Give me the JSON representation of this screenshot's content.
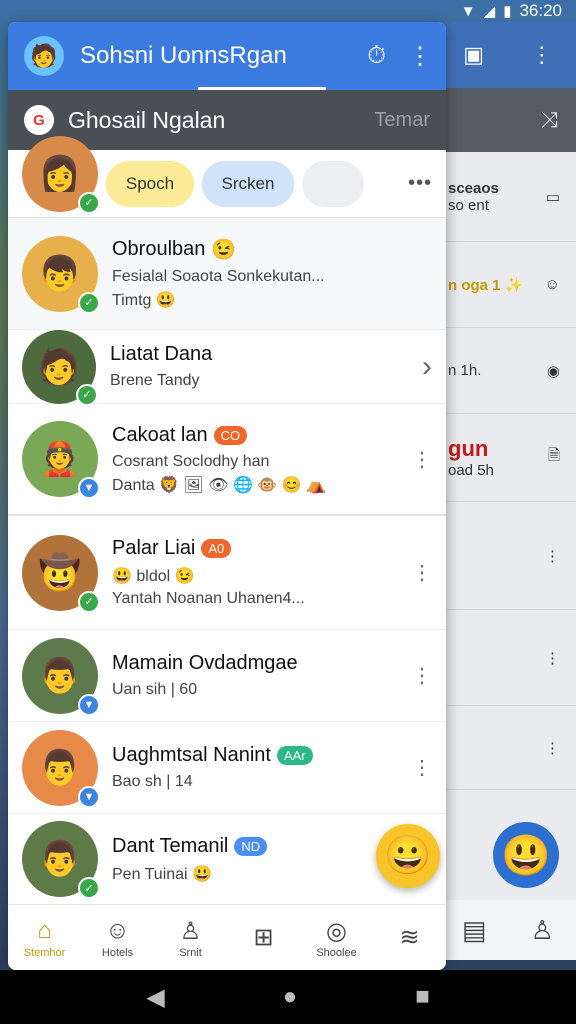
{
  "status": {
    "time": "36:20",
    "signal_icon": "signal-icon",
    "wifi_icon": "wifi-icon",
    "battery_icon": "battery-icon"
  },
  "appbar": {
    "title": "Sohsni UonnsRgan",
    "logo_icon": "app-logo-icon",
    "actions": [
      "timer-icon",
      "more-vert-icon"
    ]
  },
  "subbar": {
    "title": "Ghosail Ngalan",
    "right_text": "Temar",
    "logo_icon": "google-logo-icon"
  },
  "chips": {
    "items": [
      "Spoch",
      "Srcken",
      ""
    ],
    "more": "•••"
  },
  "contacts": [
    {
      "name": "Obroulban",
      "emoji": "😉",
      "line1": "Fesialal Soaota Sonkekutan...",
      "line2": "Timtg 😃",
      "trailing": "none",
      "badge_color": "#3aa84a"
    },
    {
      "name": "Liatat Dana",
      "line1": "Brene Tandy",
      "trailing": "chevron",
      "badge_color": "#3aa84a"
    },
    {
      "name": "Cakoat lan",
      "tag": "CO",
      "tag_color": "#f0662a",
      "line1": "Cosrant Soclodhy han",
      "line2": "Danta 🦁 🖼 👁 🌐 🐵 😊 ⛺",
      "trailing": "dots",
      "badge_color": "#3c84e2"
    },
    {
      "name": "Palar Liai",
      "tag": "A0",
      "tag_color": "#f0662a",
      "line1": "😃 bldol 😉",
      "line2": "Yantah Noanan Uhanen4...",
      "trailing": "dots",
      "badge_color": "#3aa84a"
    },
    {
      "name": "Mamain Ovdadmgae",
      "line1": "Uan sih | 60",
      "trailing": "dots",
      "badge_color": "#3c84e2"
    },
    {
      "name": "Uaghmtsal Nanint",
      "tag": "AAr",
      "tag_color": "#2bb98a",
      "line1": "Bao sh | 14",
      "trailing": "dots",
      "badge_color": "#3c84e2"
    },
    {
      "name": "Dant Temanil",
      "tag": "ND",
      "tag_color": "#4a8ef0",
      "line1": "Pen Tuinai 😃",
      "trailing": "none",
      "badge_color": "#3aa84a"
    }
  ],
  "fab_icon": "smiley-icon",
  "bottom_nav": [
    {
      "label": "Stemhor",
      "icon": "home-icon",
      "active": true
    },
    {
      "label": "Hotels",
      "icon": "face-icon",
      "active": false
    },
    {
      "label": "Srnit",
      "icon": "person-icon",
      "active": false
    },
    {
      "label": "",
      "icon": "grid-icon",
      "active": false
    },
    {
      "label": "Shoolee",
      "icon": "compass-icon",
      "active": false
    },
    {
      "label": "",
      "icon": "wave-icon",
      "active": false
    }
  ],
  "behind": {
    "rows": [
      {
        "title": "sceaos",
        "sub": "so ent",
        "icon": "chat-icon"
      },
      {
        "title": "n oga 1 ✨",
        "sub": "",
        "icon": "smile-icon"
      },
      {
        "title": "",
        "sub": "n 1h.",
        "icon": "eye-icon"
      },
      {
        "title": "gun",
        "sub": "oad 5h",
        "icon": "doc-icon"
      },
      {
        "title": "",
        "sub": "",
        "icon": "more-icon"
      },
      {
        "title": "",
        "sub": "",
        "icon": "more-icon"
      },
      {
        "title": "",
        "sub": "",
        "icon": "more-icon"
      }
    ]
  },
  "system_nav": {
    "back": "◀",
    "home": "●",
    "recents": "■"
  }
}
